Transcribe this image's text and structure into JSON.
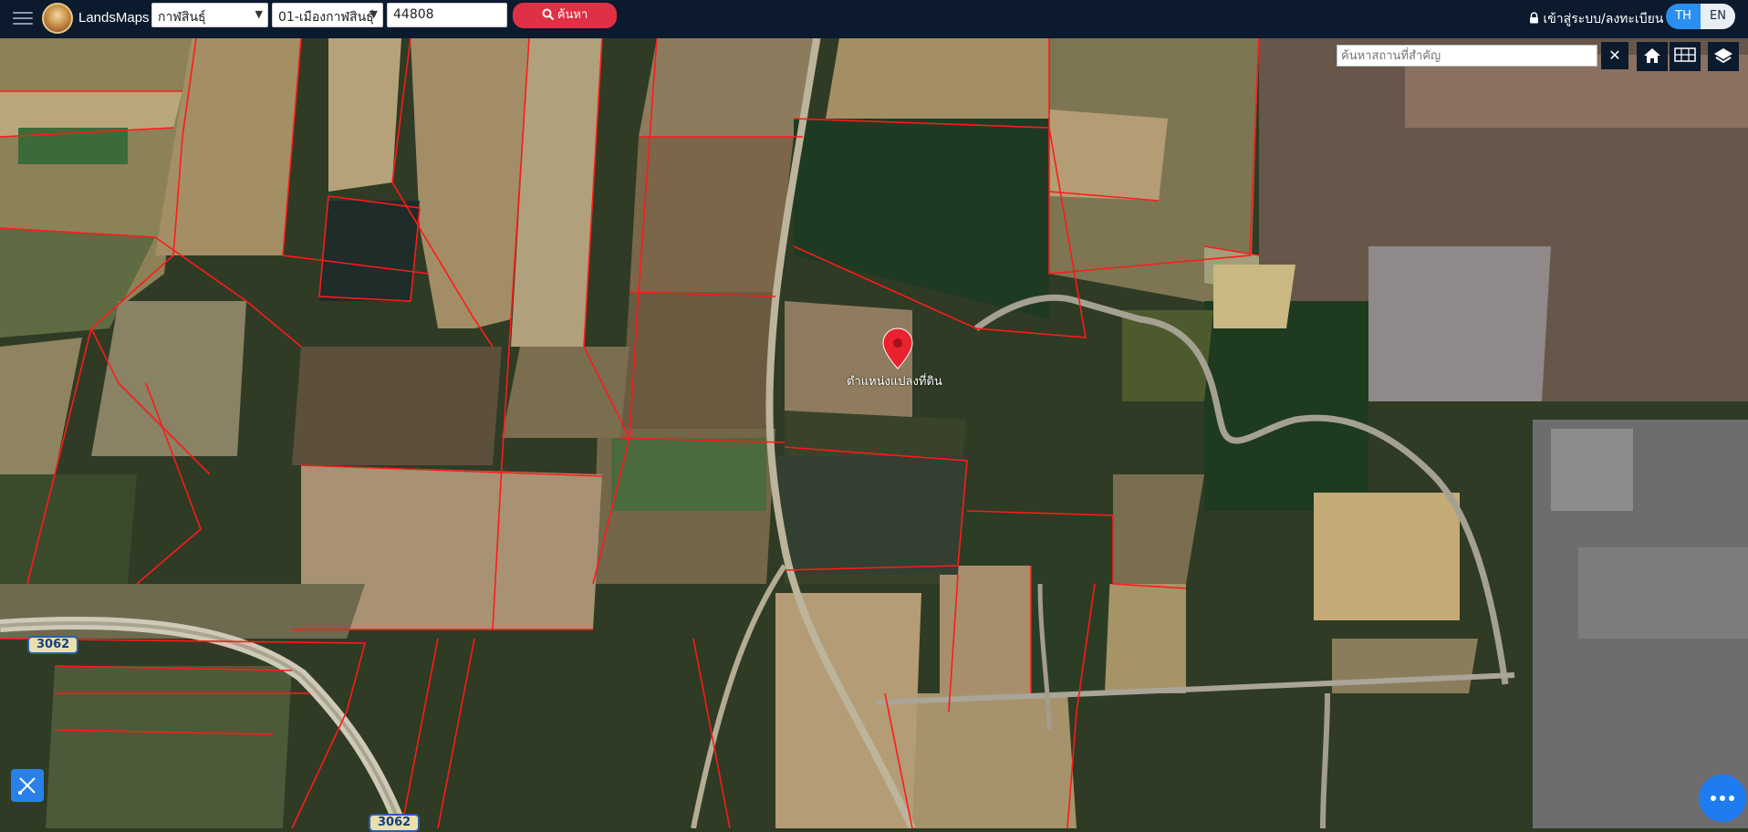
{
  "app": {
    "brand": "LandsMaps"
  },
  "search": {
    "province": "กาฬสินธุ์",
    "district": "01-เมืองกาฬสินธุ์",
    "parcel_number": "44808",
    "button_label": "ค้นหา"
  },
  "auth": {
    "login_label": "เข้าสู่ระบบ/ลงทะเบียน"
  },
  "language": {
    "th": "TH",
    "en": "EN",
    "active": "TH"
  },
  "place_search": {
    "placeholder": "ค้นหาสถานที่สำคัญ",
    "clear_label": "✕"
  },
  "map": {
    "pin_label": "ตำแหน่งแปลงที่ดิน",
    "road_labels": [
      "3062",
      "3062"
    ],
    "parcel_line_color": "#ff1a1a",
    "pin_color": "#e8222e"
  },
  "icons": [
    "menu-icon",
    "home-icon",
    "grid-icon",
    "layers-icon",
    "measure-icon",
    "chat-icon",
    "search-icon",
    "lock-icon"
  ]
}
